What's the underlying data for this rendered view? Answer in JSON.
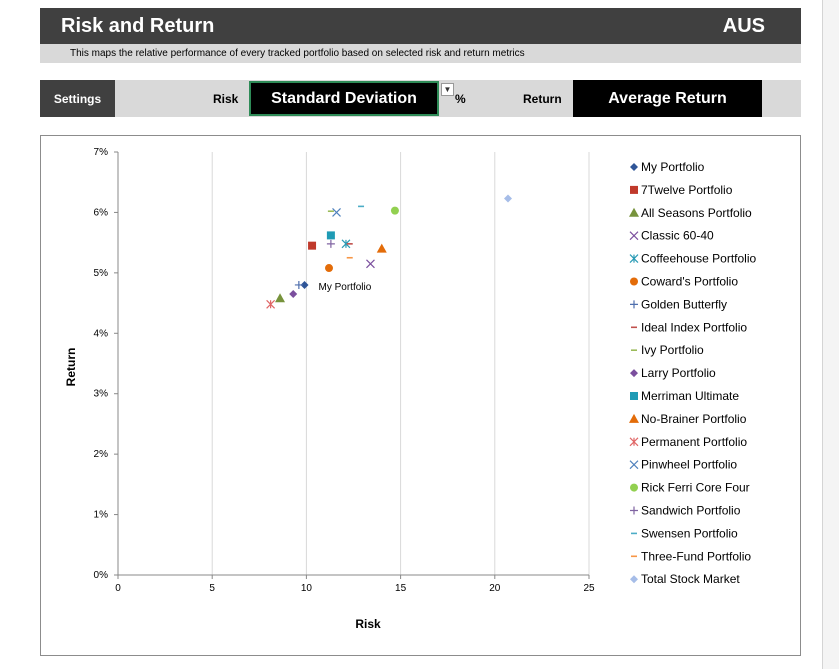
{
  "header": {
    "title": "Risk and Return",
    "region": "AUS"
  },
  "subtitle": "This maps the relative performance of every tracked portfolio based on selected risk and return metrics",
  "settings": {
    "button_label": "Settings",
    "risk_label": "Risk",
    "risk_value": "Standard Deviation",
    "unit": "%",
    "return_label": "Return",
    "return_value": "Average Return"
  },
  "chart_data": {
    "type": "scatter",
    "xlabel": "Risk",
    "ylabel": "Return",
    "xlim": [
      0,
      25
    ],
    "ylim": [
      0,
      7
    ],
    "x_ticks": [
      "0",
      "5",
      "10",
      "15",
      "20",
      "25"
    ],
    "y_ticks": [
      "0%",
      "1%",
      "2%",
      "3%",
      "4%",
      "5%",
      "6%",
      "7%"
    ],
    "grid": "vertical",
    "legend_position": "right",
    "annotation": "My Portfolio",
    "series": [
      {
        "name": "My Portfolio",
        "x": 9.9,
        "y": 4.8,
        "marker": "diamond",
        "color": "#2f5597"
      },
      {
        "name": "7Twelve Portfolio",
        "x": 10.3,
        "y": 5.45,
        "marker": "square",
        "color": "#c0392b"
      },
      {
        "name": "All Seasons Portfolio",
        "x": 8.6,
        "y": 4.58,
        "marker": "triangle",
        "color": "#77933c"
      },
      {
        "name": "Classic 60-40",
        "x": 13.4,
        "y": 5.15,
        "marker": "x",
        "color": "#7b4f9e"
      },
      {
        "name": "Coffeehouse Portfolio",
        "x": 12.1,
        "y": 5.48,
        "marker": "star",
        "color": "#2a9bb5"
      },
      {
        "name": "Coward's Portfolio",
        "x": 11.2,
        "y": 5.08,
        "marker": "circle",
        "color": "#e36c09"
      },
      {
        "name": "Golden Butterfly",
        "x": 9.6,
        "y": 4.8,
        "marker": "plus",
        "color": "#4f6fae"
      },
      {
        "name": "Ideal Index Portfolio",
        "x": 12.3,
        "y": 5.48,
        "marker": "dash",
        "color": "#c0504d"
      },
      {
        "name": "Ivy Portfolio",
        "x": 11.3,
        "y": 6.02,
        "marker": "dash",
        "color": "#9bbb59"
      },
      {
        "name": "Larry Portfolio",
        "x": 9.3,
        "y": 4.65,
        "marker": "diamond",
        "color": "#7b4f9e"
      },
      {
        "name": "Merriman Ultimate",
        "x": 11.3,
        "y": 5.62,
        "marker": "square",
        "color": "#1f9bb5"
      },
      {
        "name": "No-Brainer Portfolio",
        "x": 14.0,
        "y": 5.4,
        "marker": "triangle",
        "color": "#e36c09"
      },
      {
        "name": "Permanent Portfolio",
        "x": 8.1,
        "y": 4.48,
        "marker": "star",
        "color": "#e06666"
      },
      {
        "name": "Pinwheel Portfolio",
        "x": 11.6,
        "y": 6.0,
        "marker": "x",
        "color": "#4f81bd"
      },
      {
        "name": "Rick Ferri Core Four",
        "x": 14.7,
        "y": 6.03,
        "marker": "circle",
        "color": "#92d050"
      },
      {
        "name": "Sandwich Portfolio",
        "x": 11.3,
        "y": 5.48,
        "marker": "plus",
        "color": "#8064a2"
      },
      {
        "name": "Swensen Portfolio",
        "x": 12.9,
        "y": 6.1,
        "marker": "dash",
        "color": "#4bacc6"
      },
      {
        "name": "Three-Fund Portfolio",
        "x": 12.3,
        "y": 5.25,
        "marker": "dash",
        "color": "#f79646"
      },
      {
        "name": "Total Stock Market",
        "x": 20.7,
        "y": 6.23,
        "marker": "diamond",
        "color": "#a6bde8"
      }
    ]
  }
}
